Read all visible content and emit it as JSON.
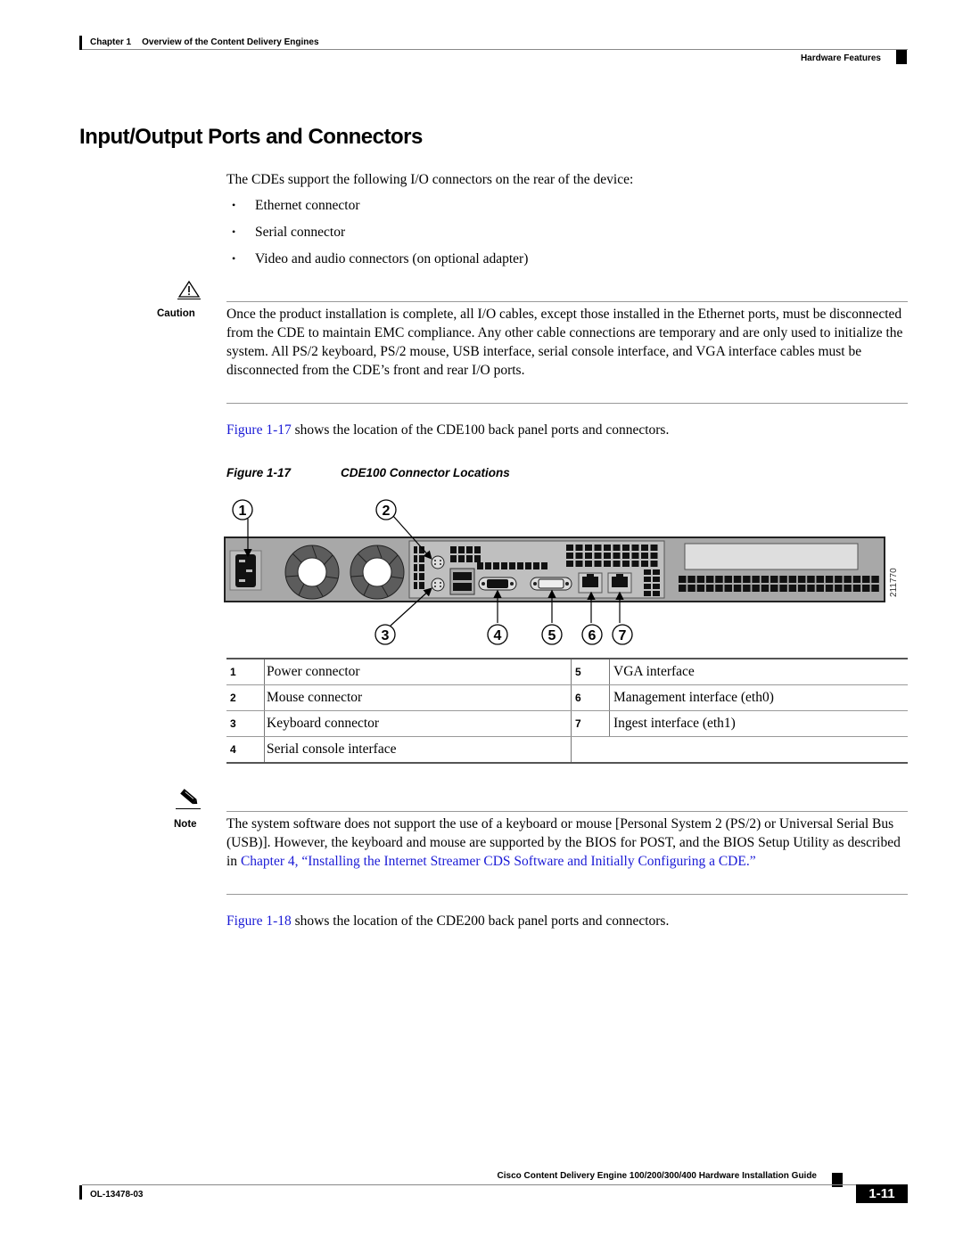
{
  "header": {
    "chapter": "Chapter 1",
    "chapter_title": "Overview of the Content Delivery Engines",
    "section": "Hardware Features"
  },
  "title": "Input/Output Ports and Connectors",
  "intro": "The CDEs support the following I/O connectors on the rear of the device:",
  "bullets": [
    "Ethernet connector",
    "Serial connector",
    "Video and audio connectors (on optional adapter)"
  ],
  "caution": {
    "icon": "warning-triangle-icon",
    "label": "Caution",
    "text": "Once the product installation is complete, all I/O cables, except those installed in the Ethernet ports, must be disconnected from the CDE to maintain EMC compliance. Any other cable connections are temporary and are only used to initialize the system. All PS/2 keyboard, PS/2 mouse, USB interface, serial console interface, and VGA interface cables must be disconnected from the CDE’s front and rear I/O ports."
  },
  "figref1": {
    "link": "Figure 1-17",
    "text": " shows the location of the CDE100 back panel ports and connectors."
  },
  "figure": {
    "number": "Figure 1-17",
    "caption": "CDE100 Connector Locations",
    "callouts": [
      "1",
      "2",
      "3",
      "4",
      "5",
      "6",
      "7"
    ],
    "art_id": "211770"
  },
  "legend": [
    {
      "n": "1",
      "desc": "Power connector",
      "n2": "5",
      "desc2": "VGA interface"
    },
    {
      "n": "2",
      "desc": "Mouse connector",
      "n2": "6",
      "desc2": "Management interface (eth0)"
    },
    {
      "n": "3",
      "desc": "Keyboard connector",
      "n2": "7",
      "desc2": "Ingest interface (eth1)"
    },
    {
      "n": "4",
      "desc": "Serial console interface",
      "n2": "",
      "desc2": ""
    }
  ],
  "note": {
    "icon": "pencil-note-icon",
    "label": "Note",
    "text_before": "The system software does not support the use of a keyboard or mouse [Personal System 2 (PS/2) or Universal Serial Bus (USB)]. However, the keyboard and mouse are supported by the BIOS for POST, and the BIOS Setup Utility as described in ",
    "link": "Chapter 4, “Installing the Internet Streamer CDS Software and Initially Configuring a CDE.”"
  },
  "figref2": {
    "link": "Figure 1-18",
    "text": " shows the location of the CDE200 back panel ports and connectors."
  },
  "footer": {
    "guide_title": "Cisco Content Delivery Engine 100/200/300/400 Hardware Installation Guide",
    "doc_number": "OL-13478-03",
    "page": "1-11"
  }
}
